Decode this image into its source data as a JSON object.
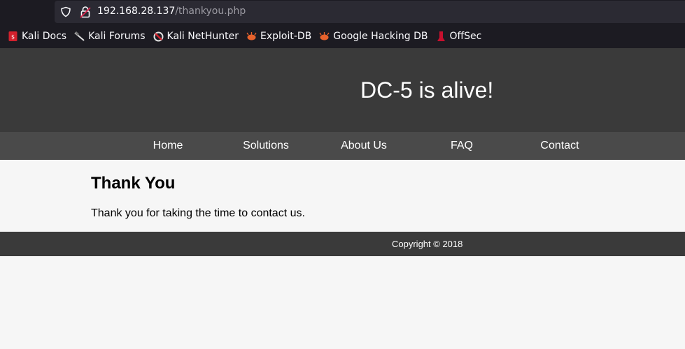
{
  "browser": {
    "url_host": "192.168.28.137",
    "url_path": "/thankyou.php",
    "bookmarks": [
      {
        "label": "Kali Docs",
        "icon": "kali-docs-icon"
      },
      {
        "label": "Kali Forums",
        "icon": "kali-forums-icon"
      },
      {
        "label": "Kali NetHunter",
        "icon": "kali-nethunter-icon"
      },
      {
        "label": "Exploit-DB",
        "icon": "exploit-db-icon"
      },
      {
        "label": "Google Hacking DB",
        "icon": "google-hacking-db-icon"
      },
      {
        "label": "OffSec",
        "icon": "offsec-icon"
      }
    ]
  },
  "site": {
    "title": "DC-5 is alive!",
    "nav": [
      "Home",
      "Solutions",
      "About Us",
      "FAQ",
      "Contact"
    ],
    "heading": "Thank You",
    "message": "Thank you for taking the time to contact us.",
    "footer": "Copyright © 2018"
  },
  "colors": {
    "header_bg": "#3a3a3a",
    "nav_bg": "#4a4a4a",
    "page_bg": "#f6f6f6",
    "chrome_bg": "#1c1b22"
  }
}
